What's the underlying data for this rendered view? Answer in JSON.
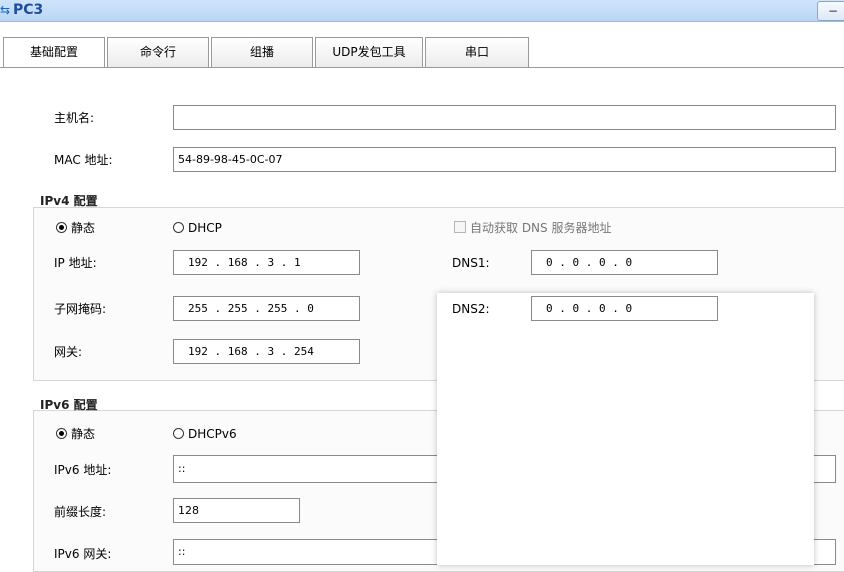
{
  "window": {
    "title": "PC3",
    "minimize_label": "−"
  },
  "tabs": [
    "基础配置",
    "命令行",
    "组播",
    "UDP发包工具",
    "串口"
  ],
  "basic": {
    "hostname_label": "主机名:",
    "hostname_value": "",
    "mac_label": "MAC 地址:",
    "mac_value": "54-89-98-45-0C-07"
  },
  "ipv4": {
    "section_title": "IPv4 配置",
    "static_label": "静态",
    "dhcp_label": "DHCP",
    "auto_dns_label": "自动获取 DNS 服务器地址",
    "ip_label": "IP 地址:",
    "ip_value": "192 . 168 .  3  .  1",
    "mask_label": "子网掩码:",
    "mask_value": "255 . 255 . 255 .  0",
    "gateway_label": "网关:",
    "gateway_value": "192 . 168 .  3  . 254",
    "dns1_label": "DNS1:",
    "dns1_value": "0  .  0  .  0  .  0",
    "dns2_label": "DNS2:",
    "dns2_value": "0  .  0  .  0  .  0"
  },
  "ipv6": {
    "section_title": "IPv6 配置",
    "static_label": "静态",
    "dhcpv6_label": "DHCPv6",
    "address_label": "IPv6 地址:",
    "address_value": "::",
    "prefix_label": "前缀长度:",
    "prefix_value": "128",
    "gateway_label": "IPv6 网关:",
    "gateway_value": "::"
  }
}
